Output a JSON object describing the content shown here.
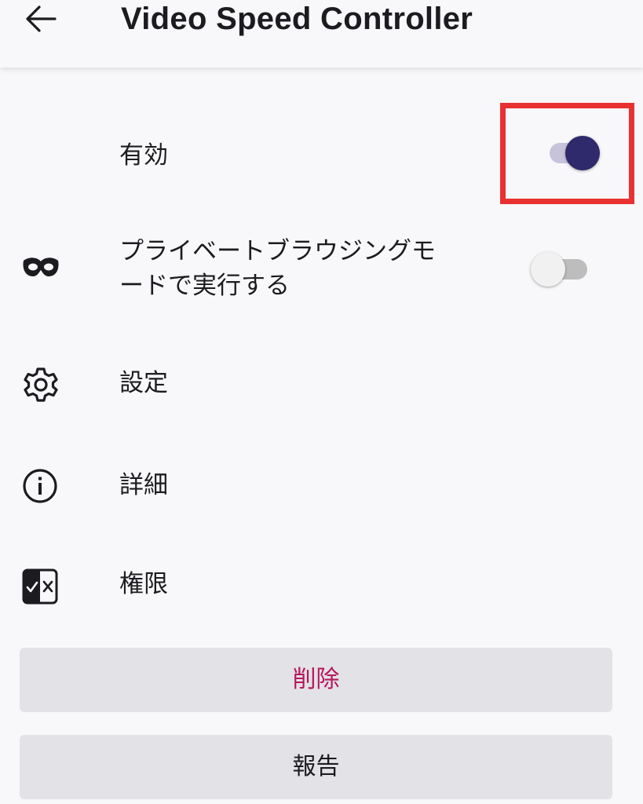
{
  "appbar": {
    "back_icon": "arrow-left-icon",
    "title": "Video Speed Controller"
  },
  "settings": {
    "enabled": {
      "label": "有効",
      "checked": true
    },
    "private_mode": {
      "icon": "mask-icon",
      "label_line1": "プライベートブラウジングモ",
      "label_line2": "ードで実行する",
      "checked": false
    },
    "settings_item": {
      "icon": "gear-icon",
      "label": "設定"
    },
    "details_item": {
      "icon": "info-icon",
      "label": "詳細"
    },
    "permissions_item": {
      "icon": "permissions-icon",
      "label": "権限"
    }
  },
  "actions": {
    "remove_label": "削除",
    "report_label": "報告"
  },
  "colors": {
    "accent": "#2e2a6b",
    "danger_text": "#b8175c",
    "highlight": "#e83131"
  }
}
